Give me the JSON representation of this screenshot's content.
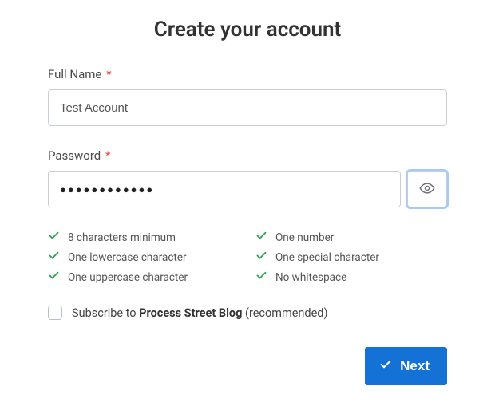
{
  "title": "Create your account",
  "fullName": {
    "label": "Full Name",
    "required": "*",
    "value": "Test Account"
  },
  "password": {
    "label": "Password",
    "required": "*",
    "masked_value": "●●●●●●●●●●●●"
  },
  "rules": {
    "min_chars": "8 characters minimum",
    "lowercase": "One lowercase character",
    "uppercase": "One uppercase character",
    "number": "One number",
    "special": "One special character",
    "no_whitespace": "No whitespace"
  },
  "subscribe": {
    "prefix": "Subscribe to ",
    "bold": "Process Street Blog",
    "suffix": " (recommended)"
  },
  "next_label": "Next",
  "colors": {
    "check_green": "#2ea44f",
    "primary_blue": "#1471d6"
  }
}
